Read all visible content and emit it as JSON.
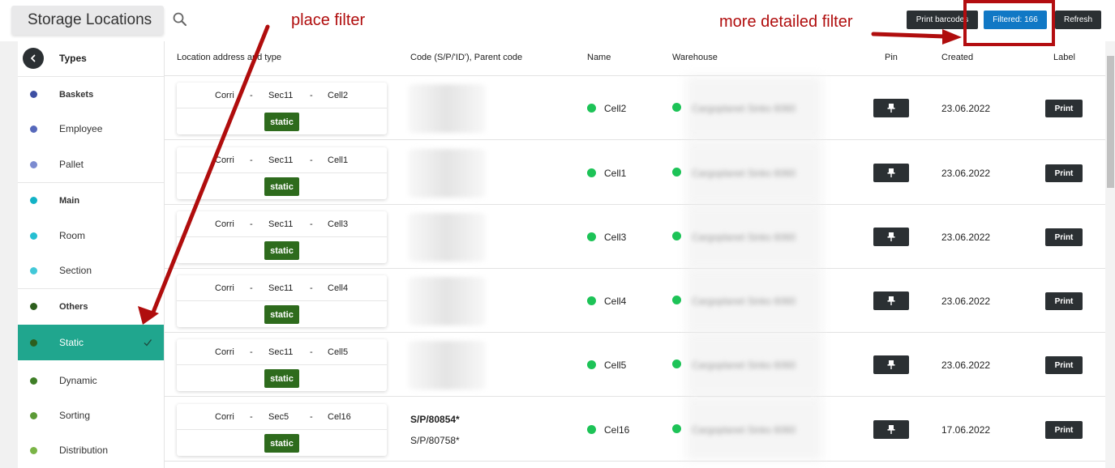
{
  "header": {
    "title": "Storage Locations",
    "search_icon": "search-icon",
    "buttons": {
      "print_barcodes": "Print barcodes",
      "filtered": "Filtered: 166",
      "refresh": "Refresh"
    }
  },
  "annotations": {
    "place_filter": "place filter",
    "more_detailed_filter": "more detailed filter",
    "color": "#b00d0d"
  },
  "sidebar": {
    "title": "Types",
    "items": [
      {
        "label": "Baskets",
        "color": "#3e4fa3",
        "group": true
      },
      {
        "label": "Employee",
        "color": "#5668bb",
        "group": false
      },
      {
        "label": "Pallet",
        "color": "#7c8bd0",
        "group": false
      },
      {
        "label": "Main",
        "color": "#12b2c6",
        "group": true
      },
      {
        "label": "Room",
        "color": "#26bfd2",
        "group": false
      },
      {
        "label": "Section",
        "color": "#42c8d8",
        "group": false
      },
      {
        "label": "Others",
        "color": "#2d5e1d",
        "group": true
      },
      {
        "label": "Static",
        "color": "#2d5e1d",
        "group": false,
        "active": true
      },
      {
        "label": "Dynamic",
        "color": "#3e7e26",
        "group": false
      },
      {
        "label": "Sorting",
        "color": "#5b9a36",
        "group": false
      },
      {
        "label": "Distribution",
        "color": "#7ab446",
        "group": false
      }
    ]
  },
  "table": {
    "headers": {
      "address": "Location address and type",
      "code": "Code (S/P/'ID'), Parent code",
      "name": "Name",
      "warehouse": "Warehouse",
      "pin": "Pin",
      "created": "Created",
      "label": "Label"
    },
    "rows": [
      {
        "corridor": "Corri",
        "section": "Sec11",
        "cell": "Cell2",
        "type": "static",
        "code": "",
        "parent_code": "",
        "name": "Cell2",
        "warehouse": "Cargoplanet Sinks 6060",
        "created": "23.06.2022",
        "print": "Print"
      },
      {
        "corridor": "Corri",
        "section": "Sec11",
        "cell": "Cell1",
        "type": "static",
        "code": "",
        "parent_code": "",
        "name": "Cell1",
        "warehouse": "Cargoplanet Sinks 6060",
        "created": "23.06.2022",
        "print": "Print"
      },
      {
        "corridor": "Corri",
        "section": "Sec11",
        "cell": "Cell3",
        "type": "static",
        "code": "",
        "parent_code": "",
        "name": "Cell3",
        "warehouse": "Cargoplanet Sinks 6060",
        "created": "23.06.2022",
        "print": "Print"
      },
      {
        "corridor": "Corri",
        "section": "Sec11",
        "cell": "Cell4",
        "type": "static",
        "code": "",
        "parent_code": "",
        "name": "Cell4",
        "warehouse": "Cargoplanet Sinks 6060",
        "created": "23.06.2022",
        "print": "Print"
      },
      {
        "corridor": "Corri",
        "section": "Sec11",
        "cell": "Cell5",
        "type": "static",
        "code": "",
        "parent_code": "",
        "name": "Cell5",
        "warehouse": "Cargoplanet Sinks 6060",
        "created": "23.06.2022",
        "print": "Print"
      },
      {
        "corridor": "Corri",
        "section": "Sec5",
        "cell": "Cel16",
        "type": "static",
        "code": "S/P/80854*",
        "parent_code": "S/P/80758*",
        "name": "Cel16",
        "warehouse": "Cargoplanet Sinks 6060",
        "created": "17.06.2022",
        "print": "Print"
      }
    ]
  },
  "colors": {
    "active_item": "#20a68e",
    "static_badge": "#2e6b1d",
    "status_green": "#1dc357",
    "dark_button": "#2b3033",
    "primary_button": "#1178c5"
  }
}
